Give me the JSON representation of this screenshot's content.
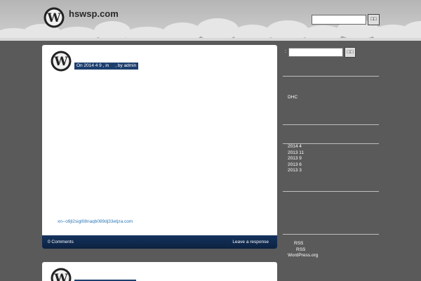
{
  "header": {
    "site_title": "hswsp.com",
    "search_button": "□□"
  },
  "posts": [
    {
      "meta": "On 2014 4 9 , in     , by admin",
      "link_text": "xn--o9jl2sigl08naqb089dj33etjza.com",
      "comments": "0 Comments",
      "respond": "Leave a response"
    }
  ],
  "sidebar": {
    "search_label": ":",
    "search_button": "□□",
    "dhc": "DHC",
    "archives": [
      "2014 4",
      "2013 11",
      "2013 9",
      "2013 6",
      "2013 3"
    ],
    "meta_links": [
      "RSS",
      "RSS",
      "WordPress.org"
    ]
  },
  "colors": {
    "background": "#5a5a5a",
    "footer_bar": "#14335e",
    "meta_badge": "#1d3f6e",
    "link": "#2a78b8"
  }
}
